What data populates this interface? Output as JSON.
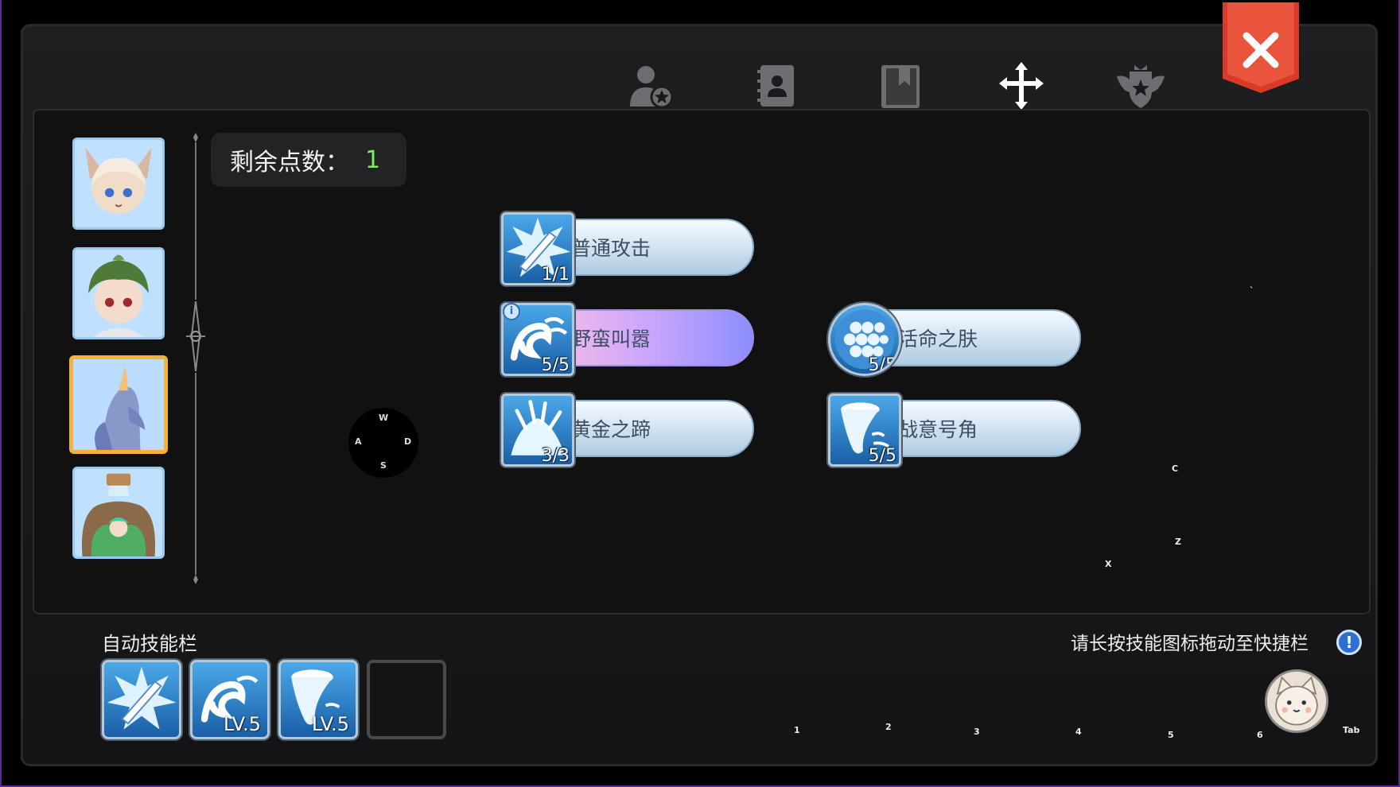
{
  "tabs": [
    {
      "icon": "user-star-icon"
    },
    {
      "icon": "contact-book-icon"
    },
    {
      "icon": "bookmark-book-icon"
    },
    {
      "icon": "cross-arrows-icon",
      "active": true
    },
    {
      "icon": "winged-emblem-icon"
    }
  ],
  "close_icon": "close-icon",
  "points": {
    "label": "剩余点数：",
    "value": "1"
  },
  "joystick": {
    "up": "W",
    "left": "A",
    "right": "D",
    "down": "S"
  },
  "skills": [
    {
      "name": "普通攻击",
      "count": "1/1",
      "icon": "sword-burst-icon",
      "highlight": false
    },
    {
      "name": "野蛮叫嚣",
      "count": "5/5",
      "icon": "roar-wave-icon",
      "highlight": true,
      "info": "i"
    },
    {
      "name": "活命之肤",
      "count": "5/5",
      "icon": "honeycomb-shield-icon",
      "highlight": false
    },
    {
      "name": "黄金之蹄",
      "count": "3/3",
      "icon": "hoof-splash-icon",
      "highlight": false
    },
    {
      "name": "战意号角",
      "count": "5/5",
      "icon": "war-horn-icon",
      "highlight": false
    }
  ],
  "keys": {
    "backtick": "`",
    "c": "C",
    "z": "Z",
    "x": "X"
  },
  "auto_bar": {
    "label": "自动技能栏",
    "slots": [
      {
        "icon": "sword-burst-icon",
        "level": ""
      },
      {
        "icon": "roar-wave-icon",
        "level": "LV.5"
      },
      {
        "icon": "war-horn-icon",
        "level": "LV.5"
      },
      {
        "icon": "",
        "level": ""
      }
    ]
  },
  "hint": {
    "text": "请长按技能图标拖动至快捷栏",
    "icon": "!"
  },
  "hotkeys": [
    "1",
    "2",
    "3",
    "4",
    "5",
    "6"
  ],
  "tab_key": "Tab"
}
